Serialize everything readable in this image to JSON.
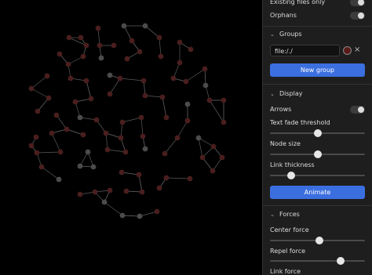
{
  "filters": {
    "existing_files_only_label": "Existing files only",
    "orphans_label": "Orphans"
  },
  "groups": {
    "title": "Groups",
    "query_value": "file:/./",
    "new_group_label": "New group",
    "remove_icon": "×"
  },
  "display": {
    "title": "Display",
    "arrows_label": "Arrows",
    "text_fade_label": "Text fade threshold",
    "text_fade_level": 0.5,
    "node_size_label": "Node size",
    "node_size_level": 0.5,
    "link_thickness_label": "Link thickness",
    "link_thickness_level": 0.22,
    "animate_label": "Animate"
  },
  "forces": {
    "title": "Forces",
    "center_force_label": "Center force",
    "center_force_level": 0.52,
    "repel_force_label": "Repel force",
    "repel_force_level": 0.74,
    "link_force_label": "Link force"
  },
  "colors": {
    "node_default": "#4a1e1e",
    "node_unresolved": "#4b4b4b",
    "link": "#5a5a5a",
    "accent": "#3b6fe0"
  }
}
